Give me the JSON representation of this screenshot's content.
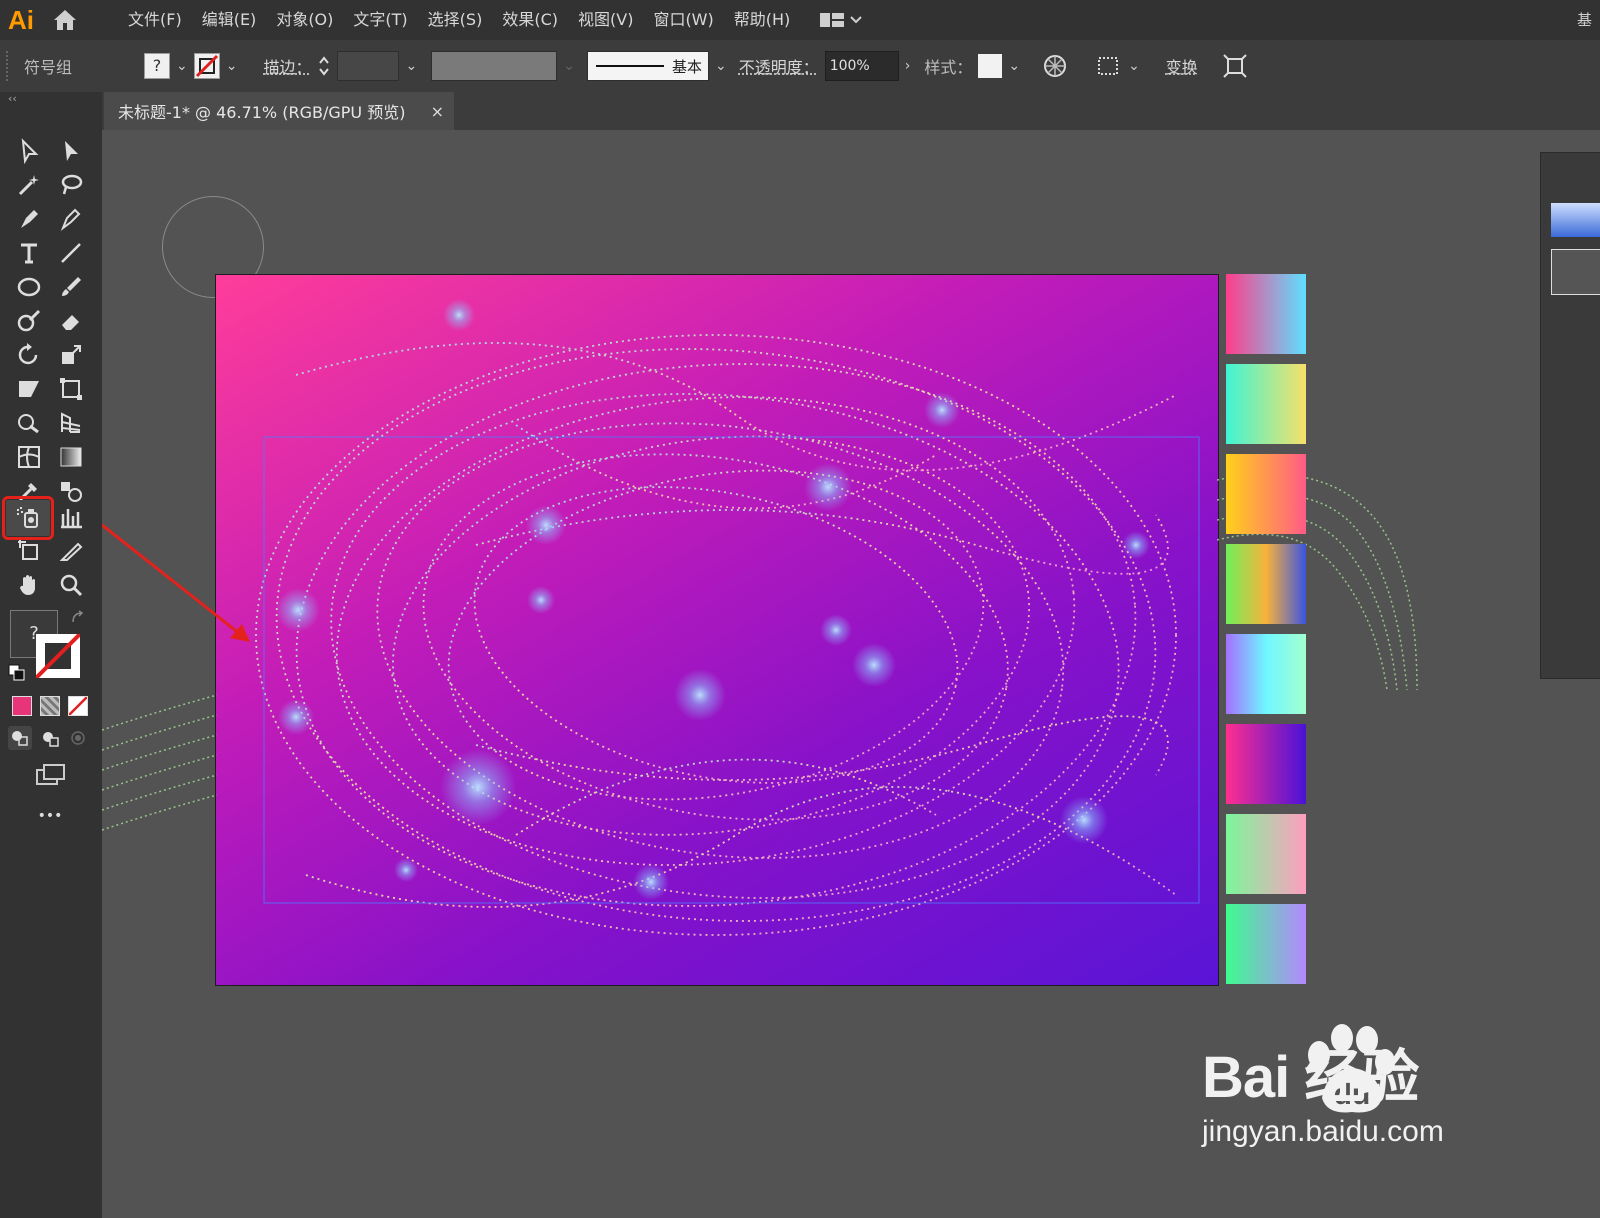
{
  "app": {
    "logo": "Ai",
    "right_stub": "基"
  },
  "menu": [
    "文件(F)",
    "编辑(E)",
    "对象(O)",
    "文字(T)",
    "选择(S)",
    "效果(C)",
    "视图(V)",
    "窗口(W)",
    "帮助(H)"
  ],
  "controlbar": {
    "object_type": "符号组",
    "fill_unknown": "?",
    "stroke_label": "描边：",
    "stroke_profile": "基本",
    "opacity_label": "不透明度：",
    "opacity_value": "100%",
    "style_label": "样式：",
    "transform_label": "变换"
  },
  "toolbar": {
    "collapse": "‹‹",
    "fill_unknown": "?",
    "more": "•••",
    "highlighted_tool": "symbol-sprayer-tool",
    "fill_color": "#e8357a",
    "highlight_color": "#e4211b"
  },
  "document": {
    "tab_title": "未标题-1* @ 46.71% (RGB/GPU 预览)",
    "close": "×"
  },
  "swatches": [
    [
      "#ff3d8a",
      "#5ee0ff"
    ],
    [
      "#3ff4d4",
      "#f7e06a"
    ],
    [
      "#ffd11a",
      "#ff5b87"
    ],
    [
      "#6ef05a",
      "#3a54e0"
    ],
    [
      "#a470ff",
      "#6ff7ff"
    ],
    [
      "#ff2f8f",
      "#4a12d8"
    ],
    [
      "#7af79a",
      "#ff9ec0"
    ],
    [
      "#3dfc8e",
      "#b488ff"
    ]
  ],
  "watermark": {
    "brand": "Bai  经验",
    "site": "jingyan.baidu.com"
  }
}
